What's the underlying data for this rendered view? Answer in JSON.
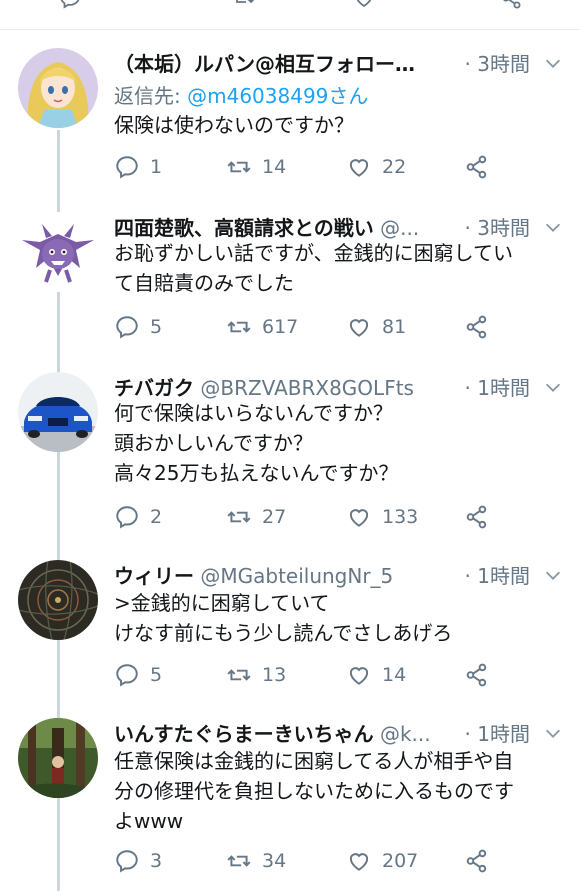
{
  "tweets": [
    {
      "name": "（本垢）ルパン@相互フォロー…",
      "handle": "",
      "dot": "·",
      "time": "3時間",
      "reply_prefix": "返信先: ",
      "reply_mention": "@m46038499さん",
      "text": "保険は使わないのですか？",
      "replies": "1",
      "retweets": "14",
      "likes": "22",
      "avatar_icon": "anime-character-avatar"
    },
    {
      "name": "四面楚歌、高額請求との戦い",
      "handle": "@...",
      "dot": "·",
      "time": "3時間",
      "text": "お恥ずかしい話ですが、金銭的に困窮してい\nて自賠責のみでした",
      "replies": "5",
      "retweets": "617",
      "likes": "81",
      "avatar_icon": "bat-creature-avatar"
    },
    {
      "name": "チバガク",
      "handle": "@BRZVABRX8GOLFts",
      "dot": "·",
      "time": "1時間",
      "text": "何で保険はいらないんですか？\n頭おかしいんですか？\n高々25万も払えないんですか？",
      "replies": "2",
      "retweets": "27",
      "likes": "133",
      "avatar_icon": "blue-car-avatar"
    },
    {
      "name": "ウィリー",
      "handle": "@MGabteilungNr_5",
      "dot": "·",
      "time": "1時間",
      "text": ">金銭的に困窮していて\nけなす前にもう少し読んでさしあげろ",
      "replies": "5",
      "retweets": "13",
      "likes": "14",
      "avatar_icon": "dark-map-avatar"
    },
    {
      "name": "いんすたぐらまーきいちゃん",
      "handle": "@k...",
      "dot": "·",
      "time": "1時間",
      "text": "任意保険は金銭的に困窮してる人が相手や自\n分の修理代を負担しないために入るものです\nよwww",
      "replies": "3",
      "retweets": "34",
      "likes": "207",
      "avatar_icon": "forest-photo-avatar"
    }
  ]
}
